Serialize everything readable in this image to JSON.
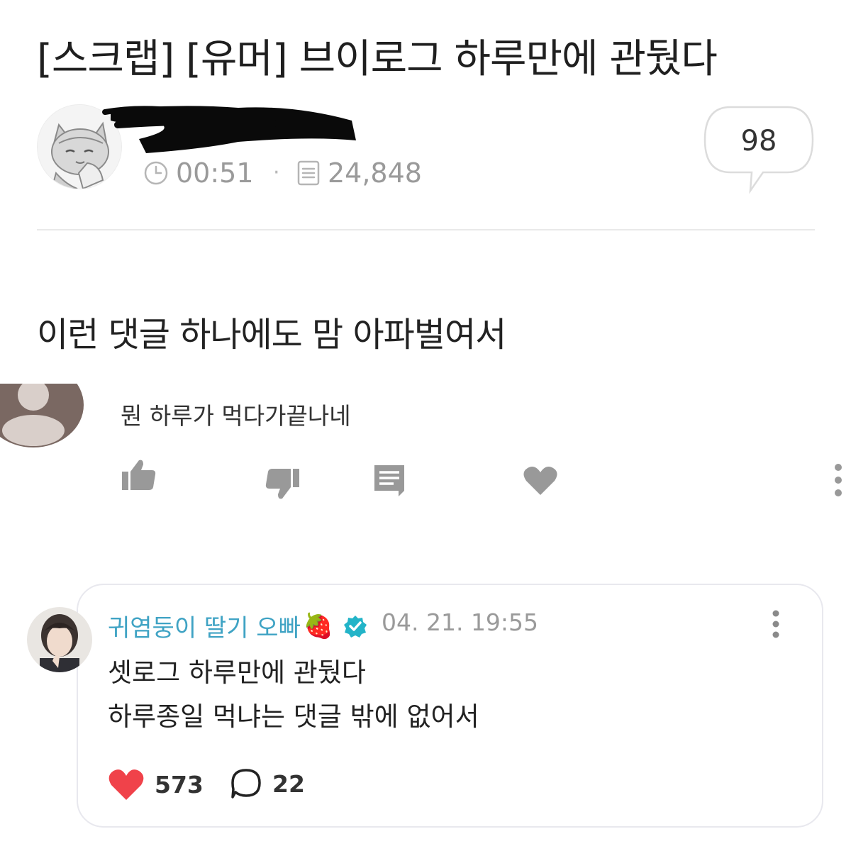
{
  "post": {
    "title": "[스크랩] [유머] 브이로그 하루만에 관뒀다",
    "time": "00:51",
    "views": "24,848",
    "comment_count": "98",
    "separator": "·",
    "body": "이런 댓글 하나에도 맘 아파벌여서"
  },
  "quoted_comment": {
    "text": "뭔 하루가 먹다가끝나네",
    "actions": [
      "thumbs-up-icon",
      "thumbs-down-icon",
      "reply-icon",
      "heart-icon",
      "more-icon"
    ]
  },
  "reply_card": {
    "author": "귀염둥이 딸기 오빠",
    "author_emoji": "🍓",
    "date": "04. 21. 19:55",
    "line1": "셋로그 하루만에 관뒀다",
    "line2": "하루종일 먹냐는 댓글 밖에 없어서",
    "likes": "573",
    "replies": "22"
  },
  "colors": {
    "accent_name": "#3fa3c4",
    "verified_badge": "#23b4c8",
    "heart_red": "#f0424a",
    "icon_gray": "#999999",
    "meta_gray": "#9a9a9a"
  }
}
